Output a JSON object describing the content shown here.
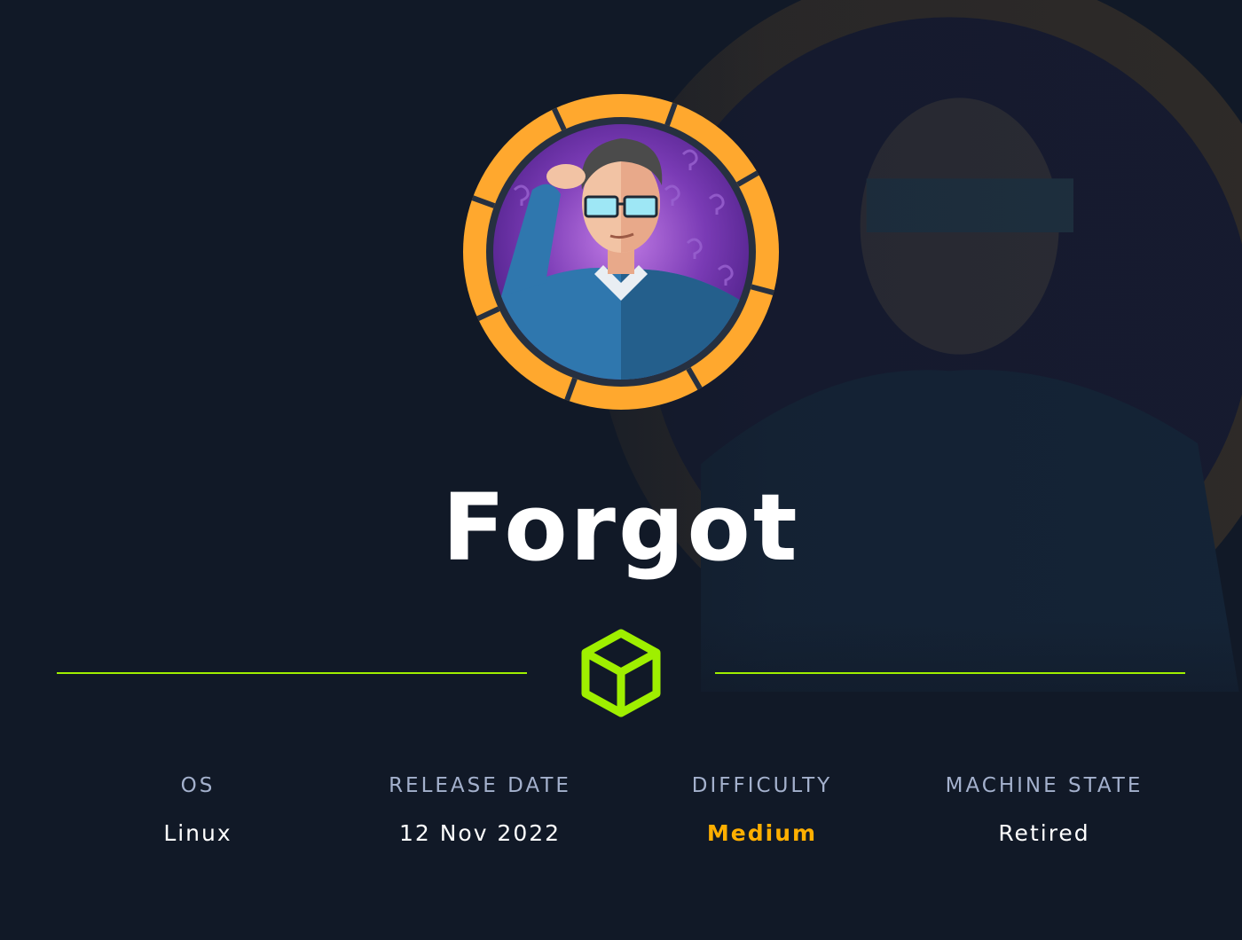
{
  "machine": {
    "name": "Forgot",
    "avatar_icon": "thinking-man-avatar-icon",
    "ring_color": "#ffa82e"
  },
  "divider": {
    "icon": "cube-icon",
    "color": "#9fef00"
  },
  "stats": [
    {
      "label": "OS",
      "value": "Linux",
      "value_color": "#ffffff"
    },
    {
      "label": "RELEASE DATE",
      "value": "12 Nov 2022",
      "value_color": "#ffffff"
    },
    {
      "label": "DIFFICULTY",
      "value": "Medium",
      "value_color": "#ffaf00"
    },
    {
      "label": "MACHINE STATE",
      "value": "Retired",
      "value_color": "#ffffff"
    }
  ],
  "colors": {
    "background": "#111927",
    "label": "#a4b1cd"
  }
}
